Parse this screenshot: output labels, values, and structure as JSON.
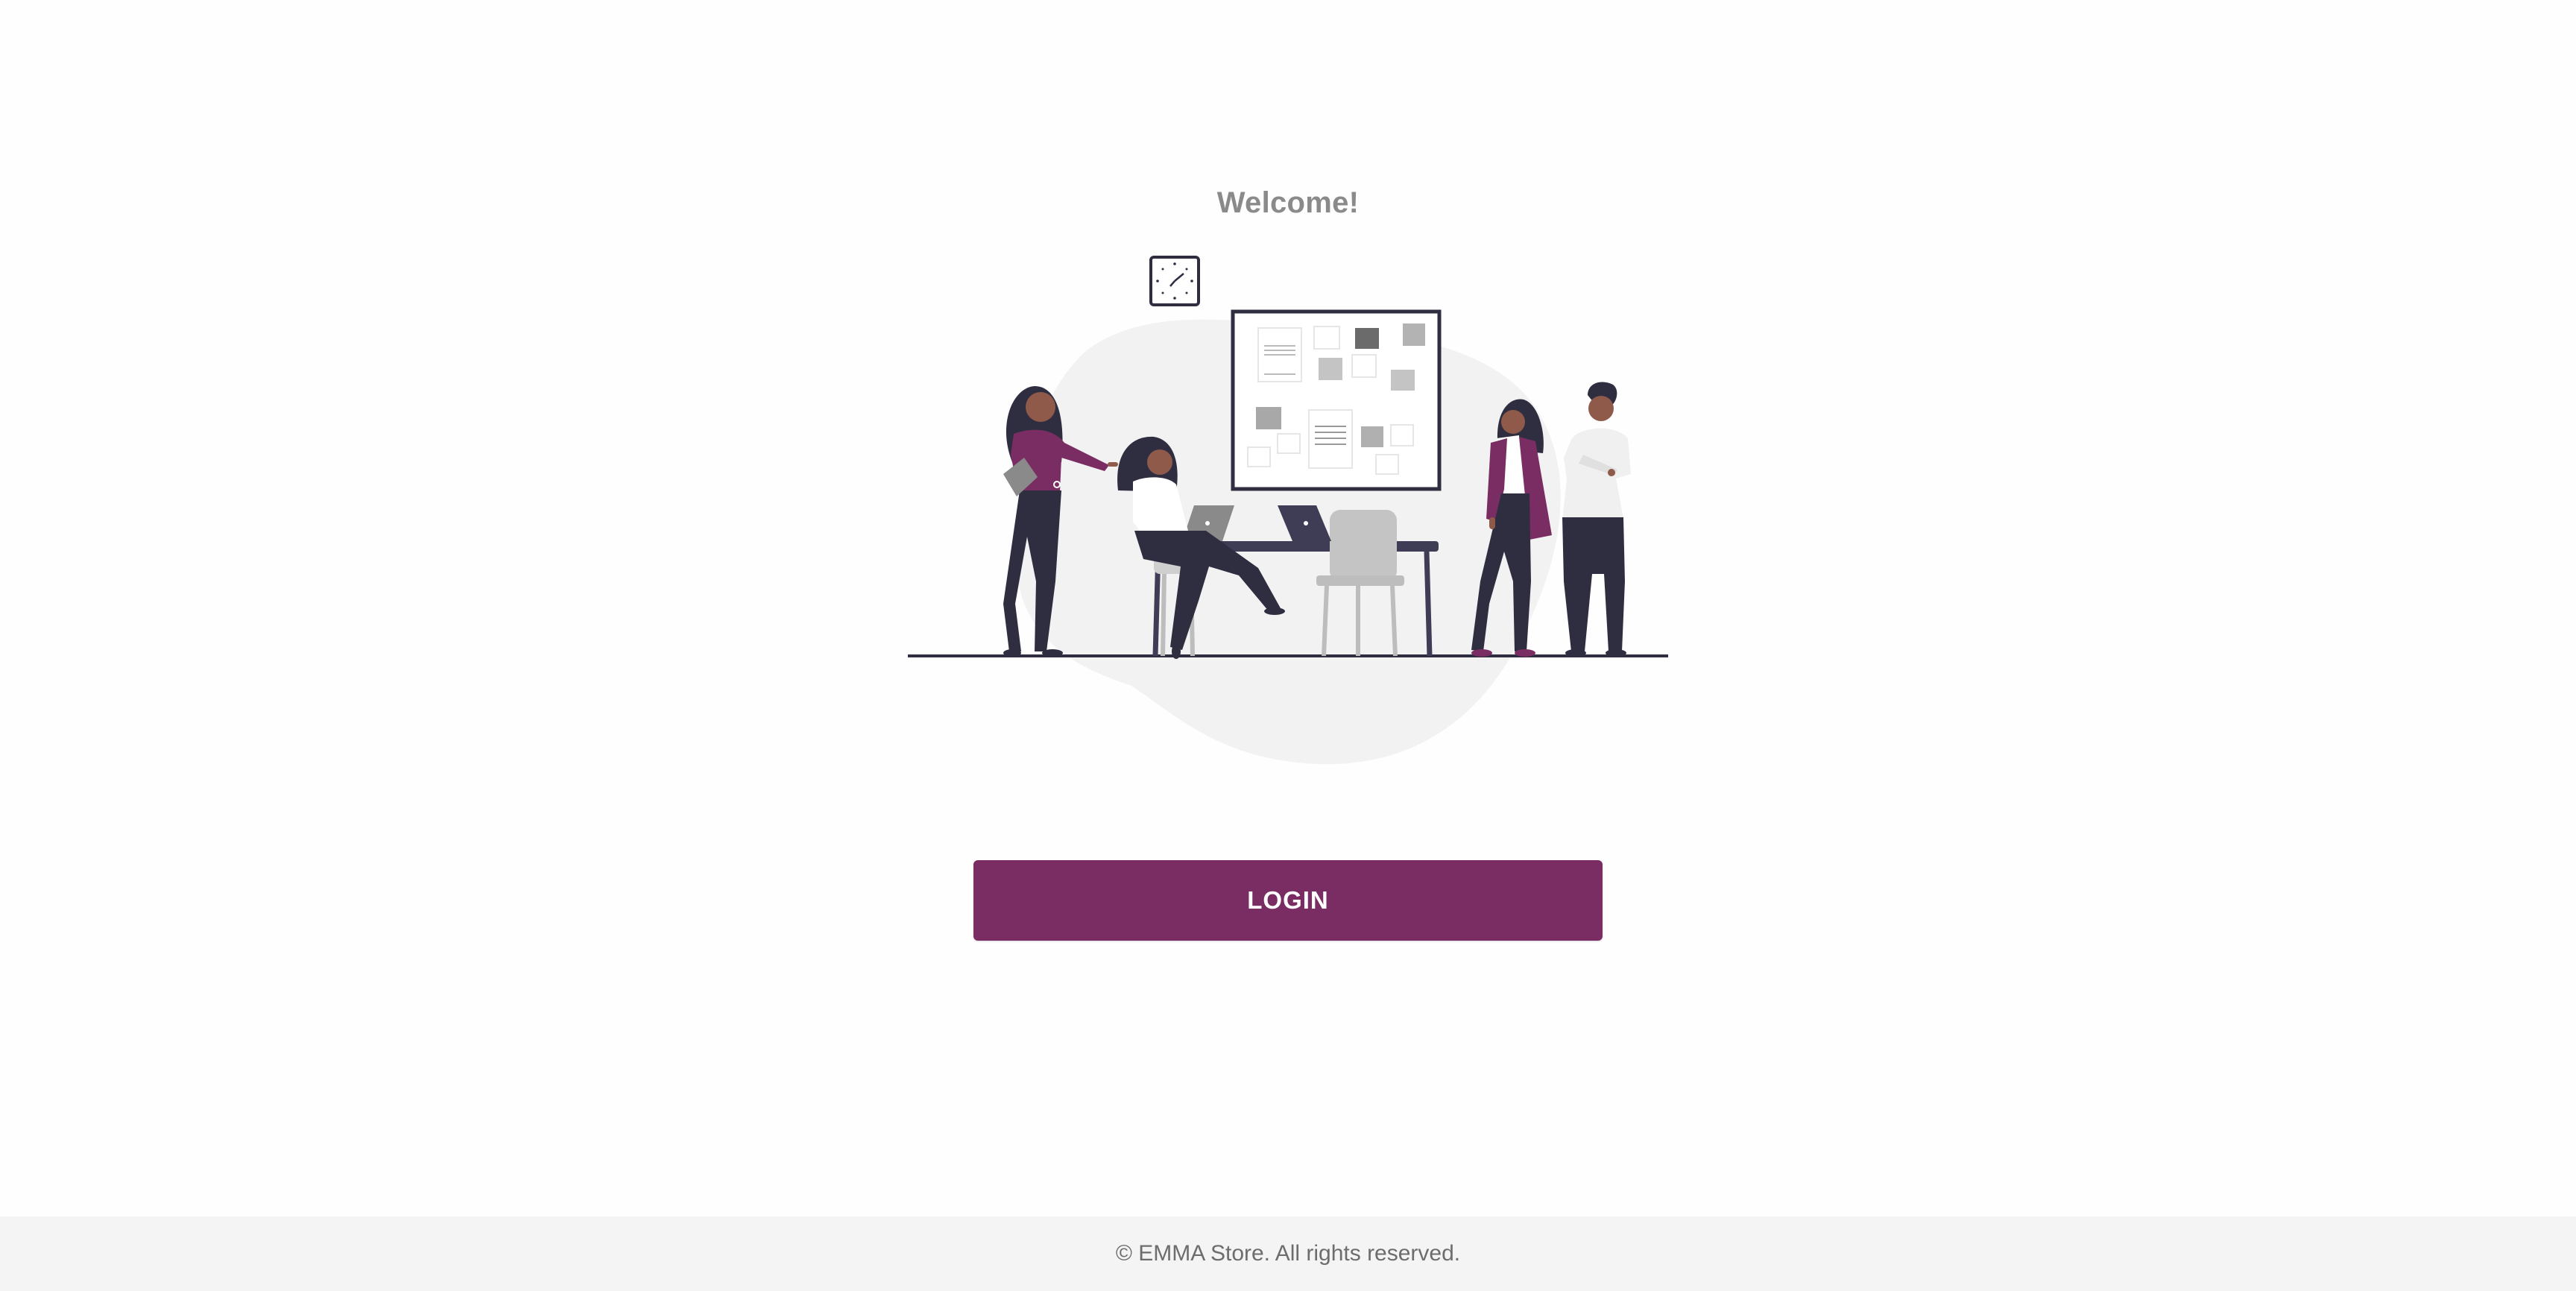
{
  "page": {
    "welcome_text": "Welcome!",
    "login_label": "LOGIN",
    "footer_text": "© EMMA Store. All rights reserved."
  },
  "illustration": {
    "subject": "team-meeting-illustration",
    "icons": [
      "wall-clock-icon",
      "pinboard-icon",
      "laptop-icon",
      "desk-icon",
      "chair-icon"
    ]
  },
  "colors": {
    "brand_primary": "#7a2d63",
    "heading_text": "#8a8a8a",
    "footer_bg": "#f4f4f4",
    "footer_text": "#6d6d6d",
    "ink": "#2f2e41"
  }
}
